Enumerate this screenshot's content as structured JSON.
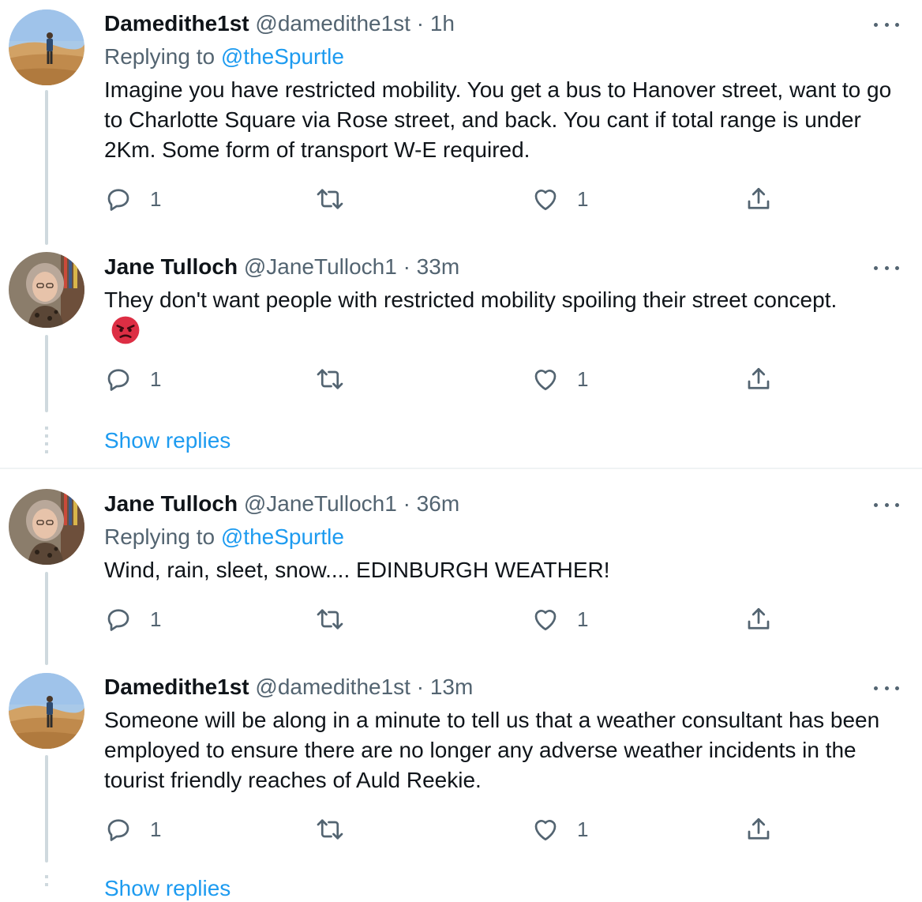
{
  "tweets": [
    {
      "name": "Damedithe1st",
      "handle": "@damedithe1st",
      "time": "· 1h",
      "replying_prefix": "Replying to",
      "replying_to": "@theSpurtle",
      "text": "Imagine you have restricted mobility. You get a bus to Hanover street, want to go to  Charlotte Square via Rose street, and back. You cant if total range is under 2Km. Some form of transport W-E required.",
      "replies": "1",
      "likes": "1"
    },
    {
      "name": "Jane Tulloch",
      "handle": "@JaneTulloch1",
      "time": "· 33m",
      "text": "They don't want people with restricted mobility spoiling their street concept.",
      "emoji": "angry-face",
      "replies": "1",
      "likes": "1",
      "show_replies": "Show replies"
    },
    {
      "name": "Jane Tulloch",
      "handle": "@JaneTulloch1",
      "time": "· 36m",
      "replying_prefix": "Replying to",
      "replying_to": "@theSpurtle",
      "text": "Wind, rain, sleet, snow.... EDINBURGH WEATHER!",
      "replies": "1",
      "likes": "1"
    },
    {
      "name": "Damedithe1st",
      "handle": "@damedithe1st",
      "time": "· 13m",
      "text": "Someone will be along in a minute to tell us that a weather consultant has been employed to ensure there are no longer any adverse weather incidents in the tourist friendly reaches of Auld Reekie.",
      "replies": "1",
      "likes": "1",
      "show_replies": "Show replies"
    }
  ],
  "colors": {
    "accent": "#1d9bf0",
    "secondary_text": "#536471",
    "thread_line": "#cfd9de"
  }
}
